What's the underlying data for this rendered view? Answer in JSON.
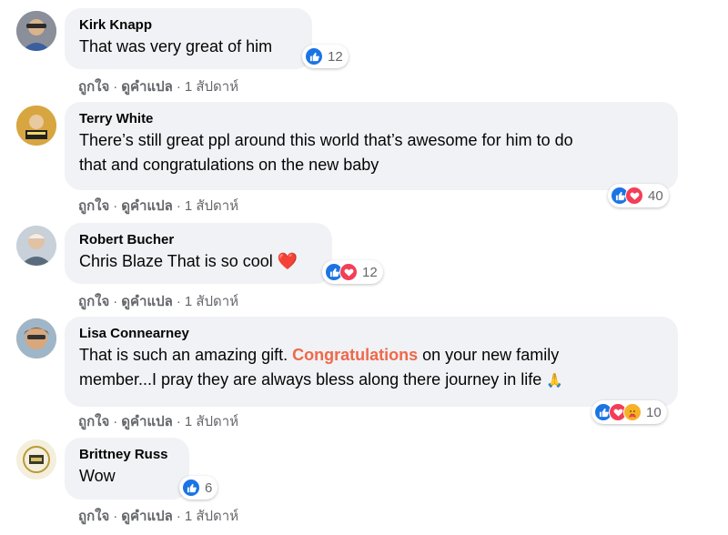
{
  "comments": [
    {
      "author": "Kirk Knapp",
      "text_lines": [
        "That was very great of him"
      ],
      "reactions": [
        "like"
      ],
      "reaction_count": "12",
      "actions": {
        "like": "ถูกใจ",
        "translate": "ดูคำแปล",
        "time": "1 สัปดาห์"
      }
    },
    {
      "author": "Terry White",
      "text_lines": [
        "There’s still great ppl around this world that’s awesome for him to do",
        "that and congratulations on the new baby"
      ],
      "reactions": [
        "like",
        "love"
      ],
      "reaction_count": "40",
      "actions": {
        "like": "ถูกใจ",
        "translate": "ดูคำแปล",
        "time": "1 สัปดาห์"
      }
    },
    {
      "author": "Robert Bucher",
      "text_lines": [
        "Chris Blaze That is so cool"
      ],
      "emoji": "❤️",
      "reactions": [
        "like",
        "love"
      ],
      "reaction_count": "12",
      "actions": {
        "like": "ถูกใจ",
        "translate": "ดูคำแปล",
        "time": "1 สัปดาห์"
      }
    },
    {
      "author": "Lisa Connearney",
      "text_line1_before": "That is such an amazing gift. ",
      "text_line1_highlight": "Congratulations",
      "text_line1_after": " on your new family",
      "text_line2": "member...I pray they are always bless along there journey in life",
      "emoji": "🙏",
      "reactions": [
        "like",
        "love",
        "care"
      ],
      "reaction_count": "10",
      "actions": {
        "like": "ถูกใจ",
        "translate": "ดูคำแปล",
        "time": "1 สัปดาห์"
      }
    },
    {
      "author": "Brittney Russ",
      "text_lines": [
        "Wow"
      ],
      "reactions": [
        "like"
      ],
      "reaction_count": "6",
      "actions": {
        "like": "ถูกใจ",
        "translate": "ดูคำแปล",
        "time": "1 สัปดาห์"
      }
    }
  ],
  "colors": {
    "like": "#1b74e4",
    "love": "#f33e58",
    "care": "#f7b125",
    "highlight": "#f0684a",
    "bubble": "#f0f2f5",
    "meta": "#65676b"
  }
}
